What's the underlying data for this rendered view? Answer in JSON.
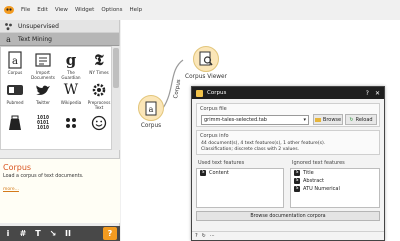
{
  "menu": [
    "File",
    "Edit",
    "View",
    "Widget",
    "Options",
    "Help"
  ],
  "sidebar": {
    "categories": [
      {
        "label": "Unsupervised"
      },
      {
        "label": "Text Mining"
      }
    ],
    "widgets": [
      {
        "label": "Corpus"
      },
      {
        "label": "Import Documents"
      },
      {
        "label": "The Guardian"
      },
      {
        "label": "NY Times"
      },
      {
        "label": "Pubmed"
      },
      {
        "label": "Twitter"
      },
      {
        "label": "Wikipedia"
      },
      {
        "label": "Preprocess Text"
      },
      {
        "label": ""
      },
      {
        "label": ""
      },
      {
        "label": ""
      },
      {
        "label": ""
      }
    ],
    "binary_glyph": "1010\n0101\n1010"
  },
  "help": {
    "title": "Corpus",
    "description": "Load a corpus of text documents.",
    "more": "more..."
  },
  "toolbar": {
    "buttons": [
      "i",
      "#",
      "T",
      "↘",
      "II"
    ],
    "help_button": "?"
  },
  "canvas": {
    "nodes": [
      {
        "label": "Corpus Viewer"
      },
      {
        "label": "Corpus"
      }
    ],
    "link_label": "Corpus"
  },
  "dialog": {
    "title": "Corpus",
    "window_buttons": [
      "?",
      "✕"
    ],
    "corpus_file": {
      "group_title": "Corpus file",
      "selected": "grimm-tales-selected.tab",
      "browse_label": "Browse",
      "reload_label": "Reload"
    },
    "corpus_info": {
      "group_title": "Corpus info",
      "lines": [
        "44 document(s), 4 text features(s), 1 other feature(s).",
        "Classification; discrete class with 2 values."
      ]
    },
    "used_features": {
      "title": "Used text features",
      "items": [
        "Content"
      ]
    },
    "ignored_features": {
      "title": "Ignored text features",
      "items": [
        "Title",
        "Abstract",
        "ATU Numerical"
      ]
    },
    "browse_corpora_label": "Browse documentation corpora",
    "status_icons": [
      "?",
      "↻",
      "⋯"
    ]
  },
  "colors": {
    "accent": "#f39b20",
    "help_title": "#d9541e",
    "node_fill": "#fbe6b8"
  }
}
